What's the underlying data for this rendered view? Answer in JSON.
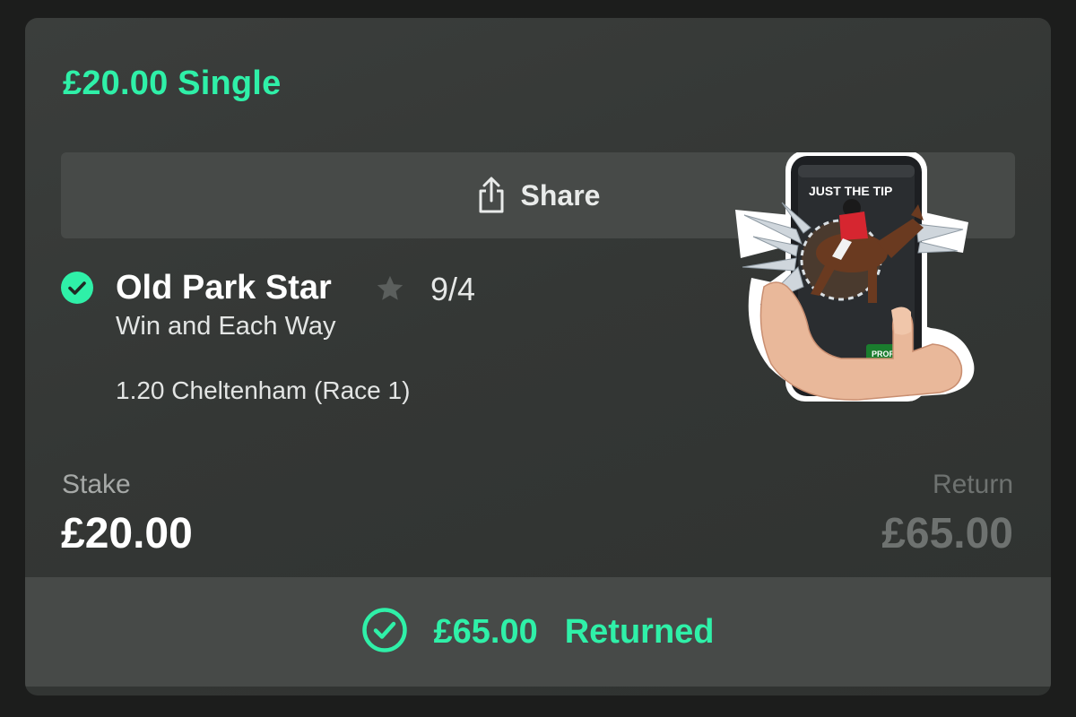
{
  "bet": {
    "title": "£20.00 Single",
    "share_label": "Share",
    "selection_name": "Old Park Star",
    "odds": "9/4",
    "bet_type": "Win and Each Way",
    "event": "1.20 Cheltenham (Race 1)",
    "stake_label": "Stake",
    "stake_value": "£20.00",
    "return_label": "Return",
    "return_value": "£65.00",
    "footer_amount": "£65.00",
    "footer_text": "Returned"
  },
  "sticker": {
    "headline": "JUST THE TIP",
    "button": "PROFIT"
  },
  "icons": {
    "share": "share-icon",
    "status": "check-circle-icon",
    "favourite": "star-icon",
    "returned": "check-circle-outline-icon"
  },
  "colors": {
    "accent": "#2ff0a8",
    "card_bg": "#363937",
    "button_bg": "#474a48",
    "muted": "#6e7270"
  }
}
